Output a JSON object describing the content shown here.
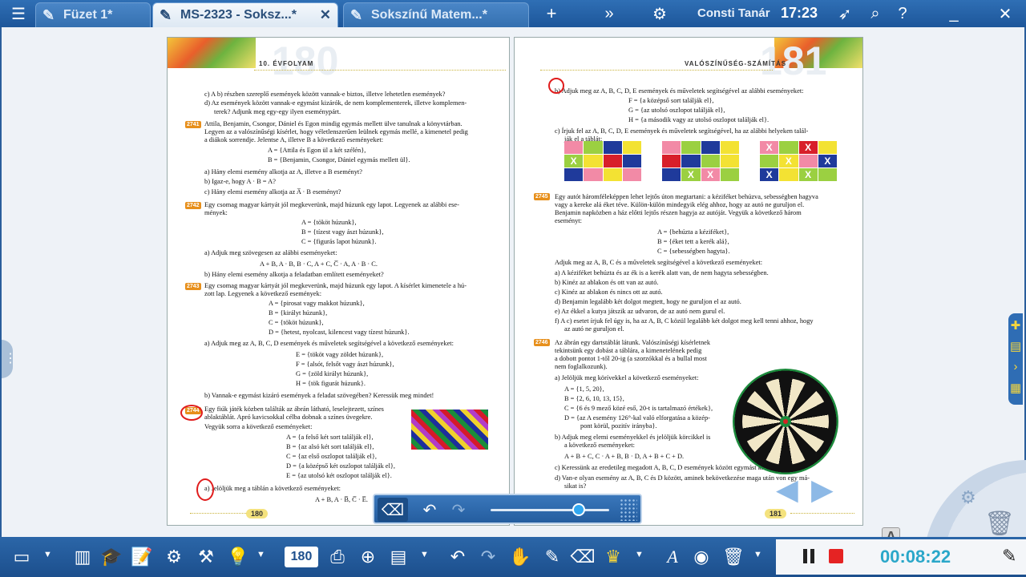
{
  "topbar": {
    "tabs": [
      {
        "label": "Füzet 1*",
        "close": ""
      },
      {
        "label": "MS-2323 - Soksz...*",
        "close": "✕"
      },
      {
        "label": "Sokszínű Matem...*",
        "close": ""
      }
    ],
    "user": "Consti Tanár",
    "time": "17:23"
  },
  "left_page": {
    "header": "10. ÉVFOLYAM",
    "big_number": "180",
    "footer": "180",
    "lines": [
      "c) A b) részben szereplő események között vannak-e biztos, illetve lehetetlen események?",
      "d) Az események között vannak-e egymást kizárók, de nem komplementerek, illetve komplemen-",
      "terek? Adjunk meg egy-egy ilyen eseménypárt.",
      "Attila, Benjamin, Csongor, Dániel és Egon mindig egymás mellett ülve tanulnak a könyvtárban.",
      "Legyen az a valószínűségi kísérlet, hogy véletlenszerűen leülnek egymás mellé, a kimenetel pedig",
      "a diákok sorrendje. Jelentse A, illetve B a következő eseményeket:",
      "A = {Attila és Egon ül a két szélén},",
      "B = {Benjamin, Csongor, Dániel egymás mellett ül}.",
      "a) Hány elemi esemény alkotja az A, illetve a B eseményt?",
      "b) Igaz-e, hogy A · B = A?",
      "c) Hány elemi esemény alkotja az A̅ · B eseményt?",
      "Egy csomag magyar kártyát jól megkeverünk, majd húzunk egy lapot. Legyenek az alábbi ese-",
      "mények:",
      "A = {tököt húzunk},",
      "B = {tízest vagy ászt húzunk},",
      "C = {figurás lapot húzunk}.",
      "a) Adjuk meg szövegesen az alábbi eseményeket:",
      "A + B,   A · B,   B · C,   A + C,   C̅ · A,   A · B · C.",
      "b) Hány elemi esemény alkotja a feladatban említett eseményeket?",
      "Egy csomag magyar kártyát jól megkeverünk, majd húzunk egy lapot. A kísérlet kimenetele a hú-",
      "zott lap. Legyenek a következő események:",
      "A = {pirosat vagy makkot húzunk},",
      "B = {királyt húzunk},",
      "C = {tököt húzunk},",
      "D = {hetest, nyolcast, kilencest vagy tízest húzunk}.",
      "a) Adjuk meg az A, B, C, D események és műveletek segítségével a következő eseményeket:",
      "E = {tököt vagy zöldet húzunk},",
      "F = {alsót, felsőt vagy ászt húzunk},",
      "G = {zöld királyt húzunk},",
      "H = {tök figurát húzunk}.",
      "b) Vannak-e egymást kizáró események a feladat szövegében? Keressük meg mindet!",
      "Egy fiúk játék közben találták az ábrán látható, leselejtezett, színes",
      "ablaktáblát. Apró kavicsokkal célba dobnak a színes üvegekre.",
      "Vegyük sorra a következő eseményeket:",
      "A = {a felső két sort találják el},",
      "B = {az alsó két sort találják el},",
      "C = {az első oszlopot találják el},",
      "D = {a középső két oszlopot találják el},",
      "E = {az utolsó két oszlopot találják el}.",
      "a) Jelöljük meg a táblán a következő eseményeket:",
      "A + B,    A · B̅,    C̅ · E̅."
    ],
    "exercise_numbers": [
      "2741",
      "2742",
      "2743",
      "2744"
    ]
  },
  "right_page": {
    "header": "VALÓSZÍNŰSÉG-SZÁMÍTÁS",
    "big_number": "181",
    "footer": "181",
    "lines": [
      "b) Adjuk meg az A, B, C, D, E események és műveletek segítségével az alábbi eseményeket:",
      "F = {a középső sort találják el},",
      "G = {az utolsó oszlopot találják el},",
      "H = {a második vagy az utolsó oszlopot találják el}.",
      "c) Írjuk fel az A, B, C, D, E események és műveletek segítségével, ha az alábbi helyeken talál-",
      "ják el a táblát:",
      "Egy autót háromféleképpen lehet lejtős úton megtartani: a kéziféket behúzva, sebességben hagyva",
      "vagy a kereke alá éket téve. Külön-külön mindegyik elég ahhoz, hogy az autó ne guruljon el.",
      "Benjamin napközben a ház előtti lejtős részen hagyja az autóját. Vegyük a következő három",
      "eseményt:",
      "A = {behúzta a kéziféket},",
      "B = {éket tett a kerék alá},",
      "C = {sebességben hagyta}.",
      "Adjuk meg az A, B, C és a műveletek segítségével a következő eseményeket:",
      "a) A kéziféket behúzta és az ék is a kerék alatt van, de nem hagyta sebességben.",
      "b) Kinéz az ablakon és ott van az autó.",
      "c) Kinéz az ablakon és nincs ott az autó.",
      "d) Benjamin legalább két dolgot megtett, hogy ne guruljon el az autó.",
      "e) Az ékkel a kutya játszik az udvaron, de az autó nem gurul el.",
      "f) A c) esetet írjuk fel úgy is, ha az A, B, C közül legalább két dolgot meg kell tenni ahhoz, hogy",
      "az autó ne guruljon el.",
      "Az ábrán egy dartstáblát látunk. Valószínűségi kísérletnek",
      "tekintsünk egy dobást a táblára, a kimenetelének pedig",
      "a dobott pontot 1-től 20-ig (a szorzókkal és a bullal most",
      "nem foglalkozunk).",
      "a) Jelöljük meg körívekkel a következő eseményeket:",
      "A = {1, 5, 20},",
      "B = {2, 6, 10, 13, 15},",
      "C = {6 és 9 mező közé eső, 20-t is tartalmazó értékek},",
      "D = {az A esemény 126°-kal való elforgatása a közép-",
      "pont körül, pozitív irányba}.",
      "b) Adjuk meg elemi eseményekkel és jelöljük körcikkel is",
      "a következő eseményeket:",
      "A + B + C,    C · A + B,    B · D,    A + B + C + D.",
      "c) Keressünk az eredetileg megadott A, B, C, D események között egymást kizárókat.",
      "d) Van-e olyan esemény az A, B, C és D között, aminek bekövetkezése maga után von egy má-",
      "sikat is?"
    ],
    "exercise_numbers": [
      "2745",
      "2746"
    ]
  },
  "grids": [
    {
      "cells": [
        "#f28aa6",
        "#9bd041",
        "#1f3a9b",
        "#f3e233",
        "#9bd041",
        "#f3e233",
        "#d81f2a",
        "#1f3a9b",
        "#1f3a9b",
        "#f28aa6",
        "#f3e233",
        "#f28aa6"
      ],
      "marks": [
        "",
        "",
        "",
        "",
        "X",
        "",
        "",
        "",
        "",
        "",
        "",
        ""
      ]
    },
    {
      "cells": [
        "#f28aa6",
        "#9bd041",
        "#1f3a9b",
        "#f3e233",
        "#d81f2a",
        "#1f3a9b",
        "#9bd041",
        "#f3e233",
        "#1f3a9b",
        "#9bd041",
        "#f28aa6",
        "#9bd041"
      ],
      "marks": [
        "",
        "",
        "",
        "",
        "",
        "",
        "",
        "",
        "",
        "X",
        "X",
        ""
      ]
    },
    {
      "cells": [
        "#f28aa6",
        "#9bd041",
        "#d81f2a",
        "#f3e233",
        "#9bd041",
        "#f3e233",
        "#f28aa6",
        "#1f3a9b",
        "#1f3a9b",
        "#f3e233",
        "#9bd041",
        "#9bd041"
      ],
      "marks": [
        "X",
        "",
        "X",
        "",
        "",
        "X",
        "",
        "X",
        "X",
        "",
        "X",
        ""
      ]
    }
  ],
  "float_toolbar": {
    "eraser": "eraser-icon",
    "undo": "undo-icon",
    "redo": "redo-icon"
  },
  "bottombar": {
    "page_number": "180",
    "timer": "00:08:22"
  },
  "colors": {
    "accent": "#245d9f",
    "timer": "#2aa7c9",
    "record": "#e52323"
  }
}
